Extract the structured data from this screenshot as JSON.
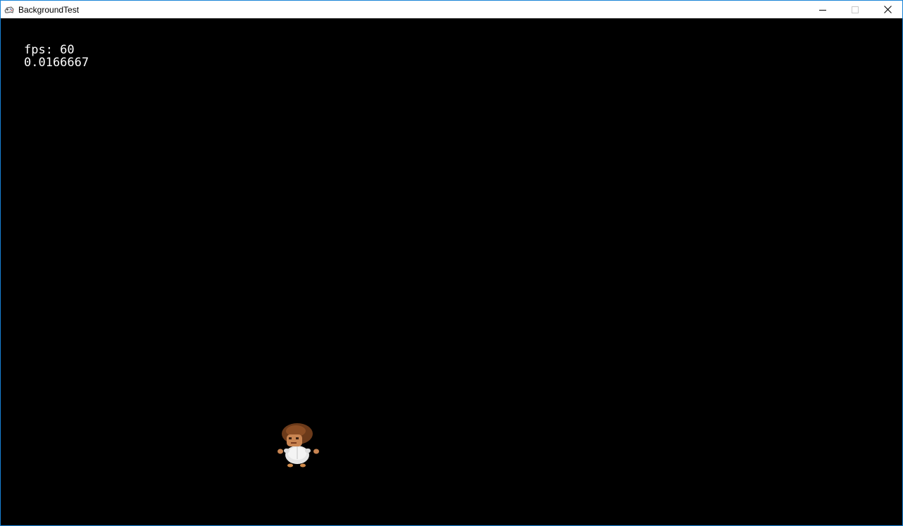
{
  "window": {
    "title": "BackgroundTest",
    "app_icon": "gamepad-icon",
    "controls": {
      "minimize_icon": "minimize-icon",
      "maximize_icon": "maximize-icon",
      "close_icon": "close-icon"
    }
  },
  "hud": {
    "fps_text": "fps: 60",
    "frame_time_text": "0.0166667"
  },
  "scene": {
    "background_color": "#000000",
    "player_sprite": "curly-haired-character-sprite"
  },
  "colors": {
    "window_border": "#1883d7",
    "hud_text": "#ffffff"
  }
}
